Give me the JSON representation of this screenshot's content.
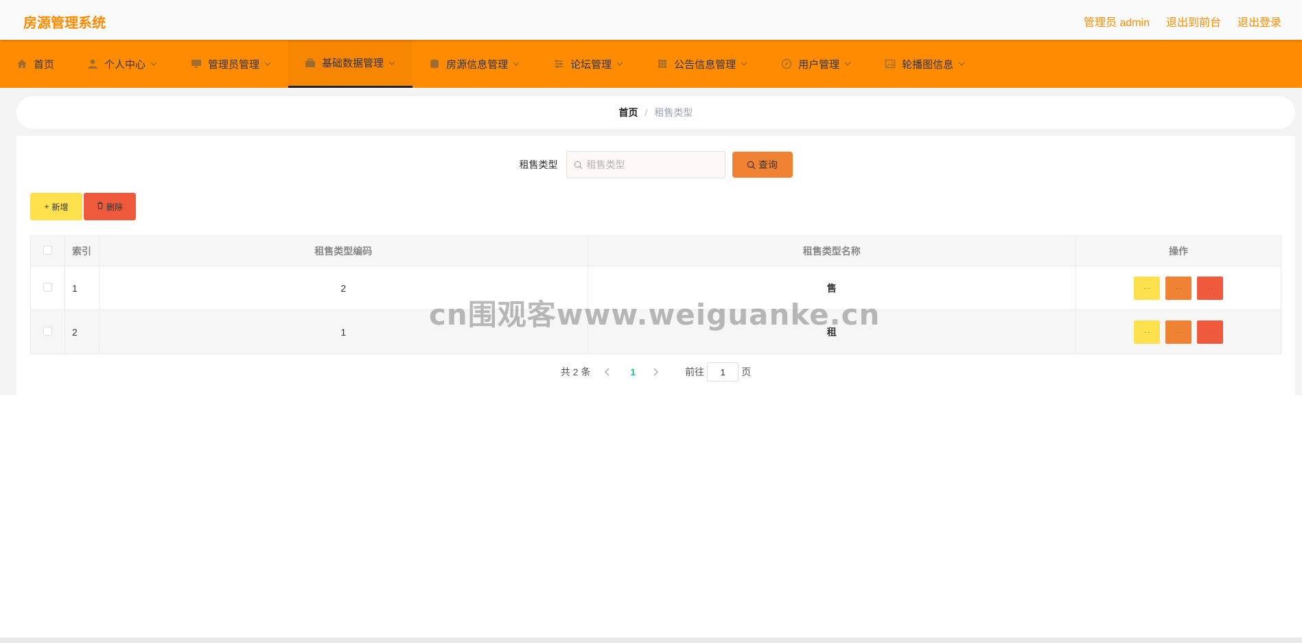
{
  "header": {
    "app_title": "房源管理系统",
    "links": [
      "管理员 admin",
      "退出到前台",
      "退出登录"
    ]
  },
  "nav": {
    "items": [
      {
        "label": "首页",
        "icon": "home-icon",
        "has_dropdown": false
      },
      {
        "label": "个人中心",
        "icon": "user-icon",
        "has_dropdown": true
      },
      {
        "label": "管理员管理",
        "icon": "monitor-icon",
        "has_dropdown": true
      },
      {
        "label": "基础数据管理",
        "icon": "briefcase-icon",
        "has_dropdown": true,
        "active": true
      },
      {
        "label": "房源信息管理",
        "icon": "database-icon",
        "has_dropdown": true
      },
      {
        "label": "论坛管理",
        "icon": "sliders-icon",
        "has_dropdown": true
      },
      {
        "label": "公告信息管理",
        "icon": "grid-icon",
        "has_dropdown": true
      },
      {
        "label": "用户管理",
        "icon": "compass-icon",
        "has_dropdown": true
      },
      {
        "label": "轮播图信息",
        "icon": "image-icon",
        "has_dropdown": true
      }
    ]
  },
  "breadcrumb": {
    "home": "首页",
    "separator": "/",
    "current": "租售类型"
  },
  "search": {
    "label": "租售类型",
    "placeholder": "租售类型",
    "button": "查询"
  },
  "actions": {
    "add": "新增",
    "delete": "删除"
  },
  "table": {
    "headers": [
      "索引",
      "租售类型编码",
      "租售类型名称",
      "操作"
    ],
    "rows": [
      {
        "index": "1",
        "code": "2",
        "name": "售"
      },
      {
        "index": "2",
        "code": "1",
        "name": "租"
      }
    ],
    "row_buttons": [
      "· ·",
      "· ·",
      "· ·"
    ]
  },
  "pagination": {
    "total": "共 2 条",
    "current_page": "1",
    "goto_label": "前往",
    "goto_value": "1",
    "page_suffix": "页"
  },
  "watermark": "cn围观客www.weiguanke.cn",
  "colors": {
    "brand": "#ff8c00",
    "query": "#f08233",
    "add": "#ffe14d",
    "delete": "#ef5a3c",
    "active_page": "#1abc9c"
  }
}
